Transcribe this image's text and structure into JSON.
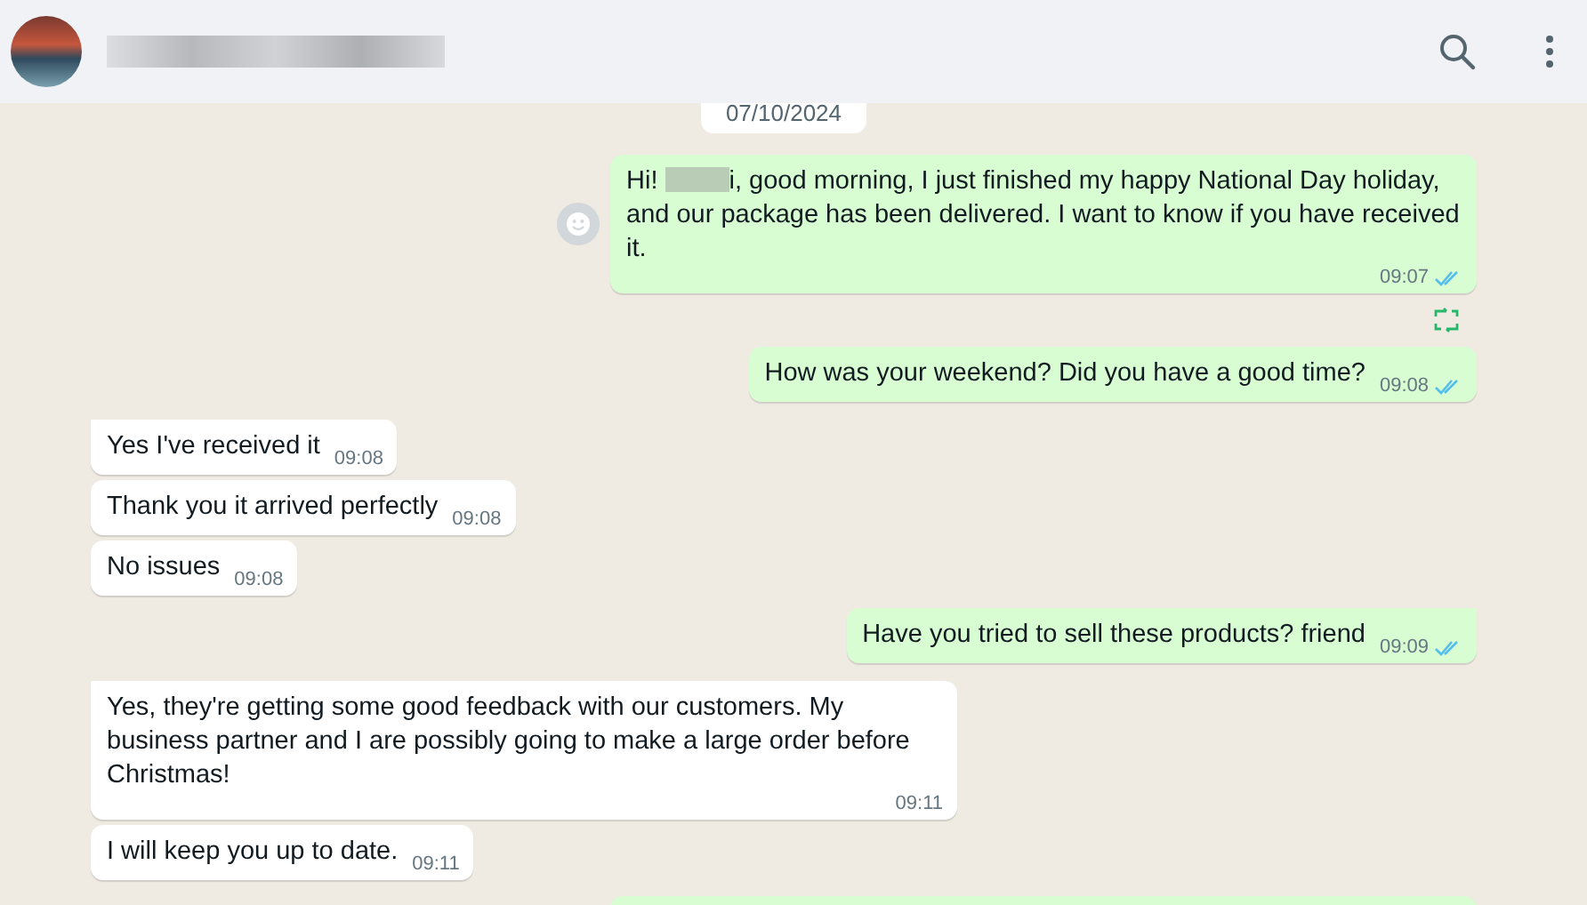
{
  "date_chip": "07/10/2024",
  "messages": [
    {
      "kind": "out",
      "redacted_prefix": "Hi!",
      "text": "i, good morning, I just finished my happy National Day holiday, and our package has been delivered. I want to know if you have received it.",
      "time": "09:07",
      "read": true,
      "emoji_button": true,
      "translated": true
    },
    {
      "kind": "out",
      "text": "How was your weekend? Did you have a good time?",
      "time": "09:08",
      "read": true
    },
    {
      "kind": "in",
      "text": "Yes I've received it",
      "time": "09:08",
      "tail": true
    },
    {
      "kind": "in",
      "text": "Thank you it arrived perfectly",
      "time": "09:08"
    },
    {
      "kind": "in",
      "text": "No issues",
      "time": "09:08"
    },
    {
      "kind": "out",
      "text": "Have you tried to sell these products? friend",
      "time": "09:09",
      "read": true,
      "tail": true
    },
    {
      "kind": "in",
      "text": "Yes, they're getting some good feedback with our customers. My business partner and I are possibly going to make a large order before Christmas!",
      "time": "09:11",
      "tail": true
    },
    {
      "kind": "in",
      "text": "I will keep you up to date.",
      "time": "09:11"
    },
    {
      "kind": "out_partial"
    }
  ]
}
